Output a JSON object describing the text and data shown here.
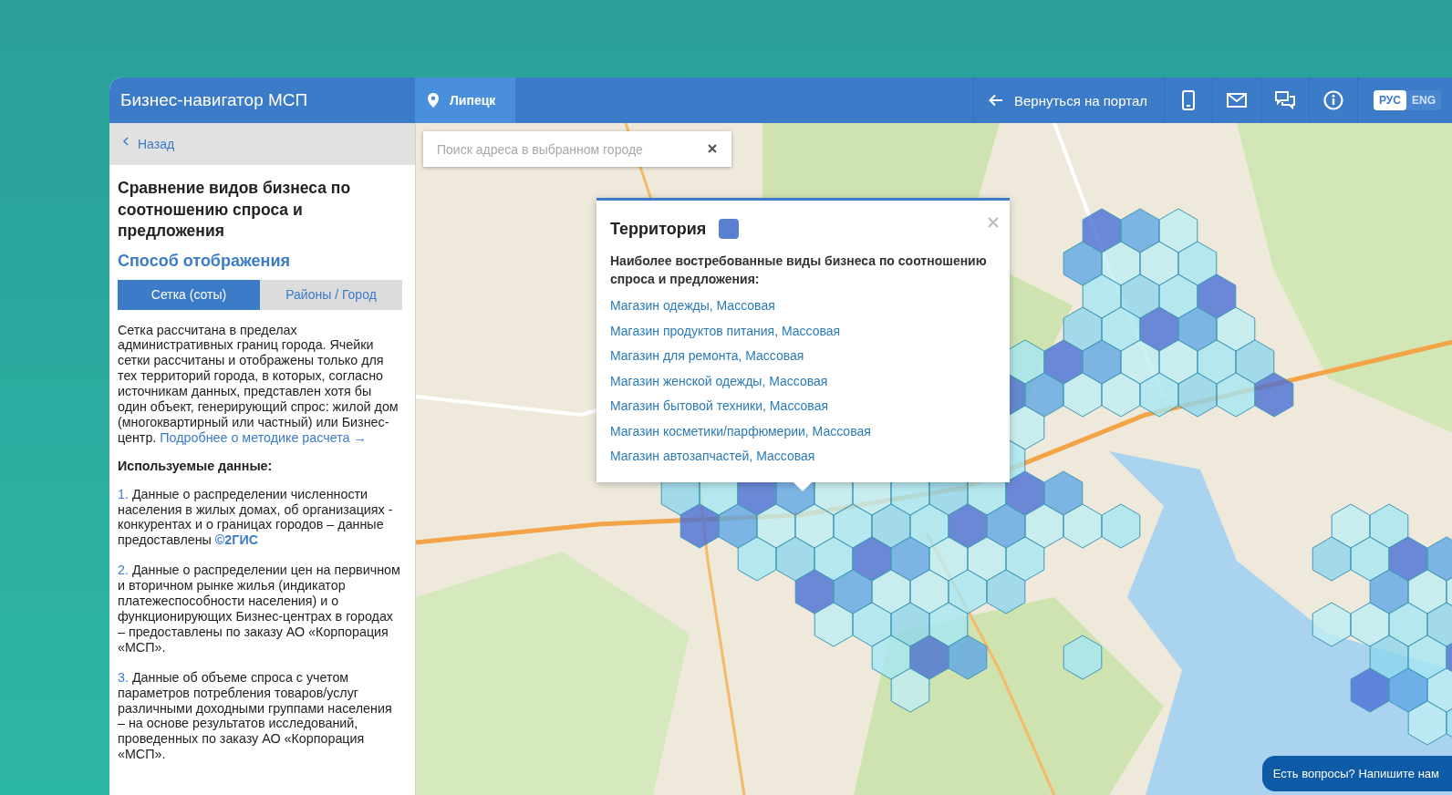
{
  "header": {
    "title": "Бизнес-навигатор МСП",
    "city": "Липецк",
    "back_link": "Вернуться на портал",
    "languages": [
      {
        "label": "РУС",
        "selected": true
      },
      {
        "label": "ENG",
        "selected": false
      }
    ]
  },
  "sidebar": {
    "back": "Назад",
    "heading": "Сравнение видов бизнеса по соотношению спроса и предложения",
    "section_title": "Способ отображения",
    "view_tabs": [
      {
        "label": "Сетка (соты)",
        "selected": true
      },
      {
        "label": "Районы / Город",
        "selected": false
      }
    ],
    "description": {
      "text": "Сетка рассчитана в пределах административных границ города. Ячейки сетки рассчитаны и отображены только для тех территорий города, в которых, согласно источникам данных, представлен хотя бы один объект, генерирующий спрос: жилой дом (многоквартирный или частный) или Бизнес-центр.",
      "link": "Подробнее о методике расчета →"
    },
    "data_title": "Используемые данные:",
    "sources": [
      {
        "number": "1.",
        "text": "Данные о распределении численности населения в жилых домах, об организациях - конкурентах и о границах городов – данные предоставлены",
        "link": "©2ГИС"
      },
      {
        "number": "2.",
        "text": "Данные о распределении цен на первичном и вторичном рынке жилья (индикатор платежеспособности населения) и о функционирующих Бизнес-центрах в городах – предоставлены по заказу АО «Корпорация «МСП»."
      },
      {
        "number": "3.",
        "text": "Данные об объеме спроса с учетом параметров потребления товаров/услуг различными доходными группами населения – на основе результатов исследований, проведенных по заказу АО «Корпорация «МСП»."
      }
    ]
  },
  "map": {
    "kind": "picture",
    "search": {
      "placeholder": "Поиск адреса в выбранном городе"
    },
    "popup": {
      "title": "Территория",
      "color": "#5b7fcf",
      "subtitle": "Наиболее востребованные виды бизнеса по соотношению спроса и предложения:",
      "items": [
        "Магазин одежды, Массовая",
        "Магазин продуктов питания, Массовая",
        "Магазин для ремонта, Массовая",
        "Магазин женской одежды, Массовая",
        "Магазин бытовой техники, Массовая",
        "Магазин косметики/парфюмерии, Массовая",
        "Магазин автозапчастей, Массовая"
      ]
    }
  },
  "chat_button": "Есть вопросы? Напишите нам"
}
